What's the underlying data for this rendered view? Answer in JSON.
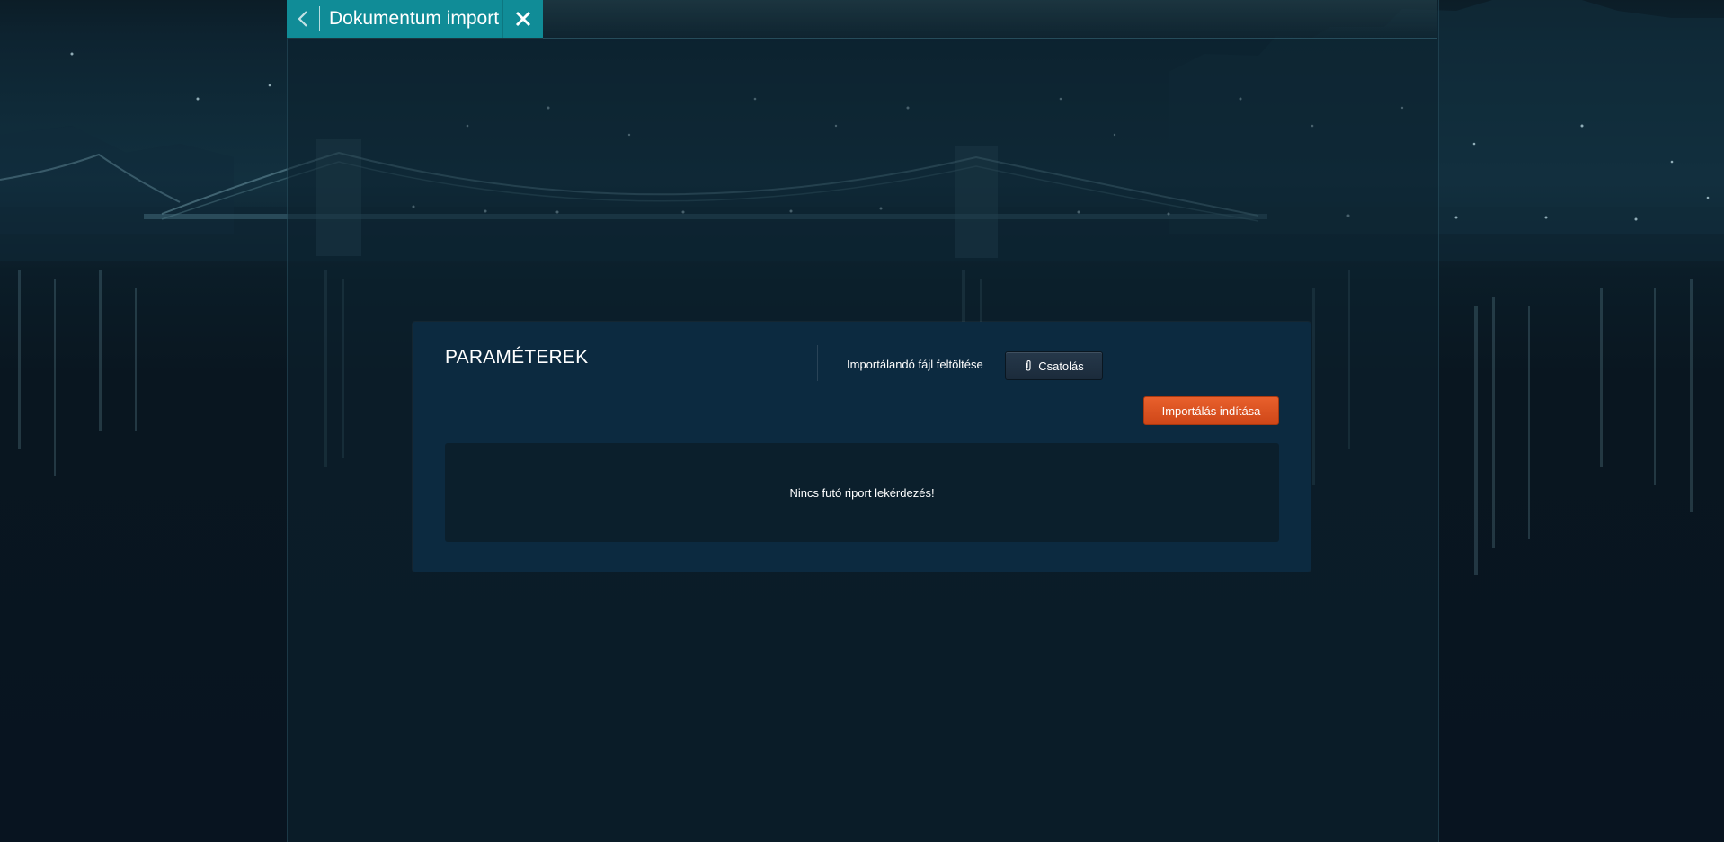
{
  "header": {
    "title": "Dokumentum import",
    "back_icon": "chevron-left-icon",
    "close_icon": "close-icon",
    "accent_color": "#108c97"
  },
  "panel": {
    "title": "PARAMÉTEREK",
    "upload_label": "Importálandó fájl feltöltése",
    "attach_button_label": "Csatolás",
    "attach_icon": "paperclip-icon",
    "import_button_label": "Importálás indítása",
    "import_button_color": "#e0562a",
    "report_message": "Nincs futó riport lekérdezés!"
  }
}
